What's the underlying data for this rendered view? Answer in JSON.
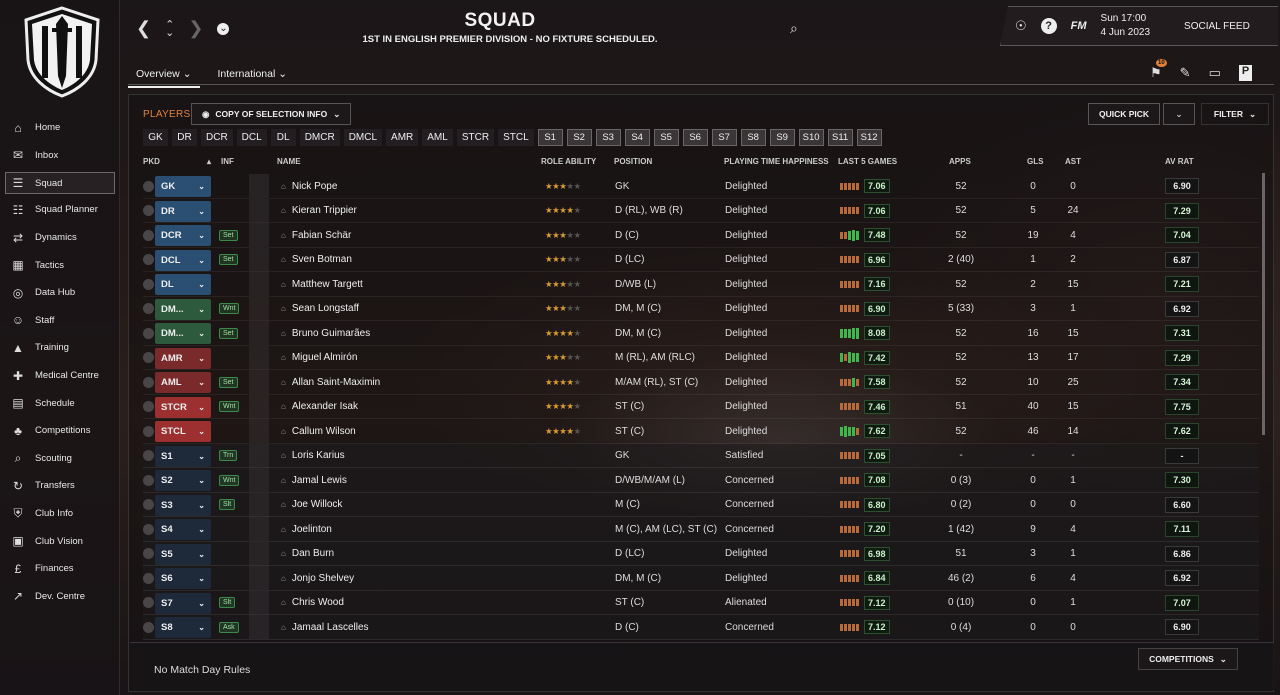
{
  "header": {
    "title": "SQUAD",
    "subtitle": "1ST IN ENGLISH PREMIER DIVISION - NO FIXTURE SCHEDULED.",
    "fm": "FM",
    "time": "Sun 17:00",
    "date": "4 Jun 2023",
    "social_feed": "SOCIAL FEED",
    "notif_count": "10"
  },
  "sidebar": {
    "items": [
      {
        "label": "Home",
        "icon": "home-icon"
      },
      {
        "label": "Inbox",
        "icon": "inbox-icon"
      },
      {
        "label": "Squad",
        "icon": "squad-icon"
      },
      {
        "label": "Squad Planner",
        "icon": "clipboard-icon"
      },
      {
        "label": "Dynamics",
        "icon": "dynamics-icon"
      },
      {
        "label": "Tactics",
        "icon": "tactics-icon"
      },
      {
        "label": "Data Hub",
        "icon": "data-hub-icon"
      },
      {
        "label": "Staff",
        "icon": "staff-icon"
      },
      {
        "label": "Training",
        "icon": "training-icon"
      },
      {
        "label": "Medical Centre",
        "icon": "medical-icon"
      },
      {
        "label": "Schedule",
        "icon": "calendar-icon"
      },
      {
        "label": "Competitions",
        "icon": "trophy-icon"
      },
      {
        "label": "Scouting",
        "icon": "scouting-icon"
      },
      {
        "label": "Transfers",
        "icon": "transfers-icon"
      },
      {
        "label": "Club Info",
        "icon": "shield-icon"
      },
      {
        "label": "Club Vision",
        "icon": "briefcase-icon"
      },
      {
        "label": "Finances",
        "icon": "finances-icon"
      },
      {
        "label": "Dev. Centre",
        "icon": "dev-centre-icon"
      }
    ]
  },
  "tabs": {
    "overview": "Overview",
    "international": "International"
  },
  "toolbar": {
    "players": "PLAYERS",
    "copy": "COPY OF SELECTION INFO",
    "quick_pick": "QUICK PICK",
    "filter": "FILTER"
  },
  "position_chips": [
    "GK",
    "DR",
    "DCR",
    "DCL",
    "DL",
    "DMCR",
    "DMCL",
    "AMR",
    "AML",
    "STCR",
    "STCL"
  ],
  "sub_chips": [
    "S1",
    "S2",
    "S3",
    "S4",
    "S5",
    "S6",
    "S7",
    "S8",
    "S9",
    "S10",
    "S11",
    "S12"
  ],
  "columns": {
    "pkd": "PKD",
    "inf": "INF",
    "name": "NAME",
    "role_ability": "ROLE ABILITY",
    "position": "POSITION",
    "happiness": "PLAYING TIME HAPPINESS",
    "last5": "LAST 5 GAMES",
    "apps": "APPS",
    "gls": "GLS",
    "ast": "AST",
    "av_rat": "AV RAT"
  },
  "players": [
    {
      "pkd": "GK",
      "pkd_color": "#2a4f72",
      "inf": "",
      "name": "Nick Pope",
      "stars": 3,
      "position": "GK",
      "happiness": "Delighted",
      "last5": "7.06",
      "apps": "52",
      "gls": "0",
      "ast": "0",
      "avrat": "6.90",
      "sub": false
    },
    {
      "pkd": "DR",
      "pkd_color": "#2a4f72",
      "inf": "",
      "name": "Kieran Trippier",
      "stars": 3.5,
      "position": "D (RL), WB (R)",
      "happiness": "Delighted",
      "last5": "7.06",
      "apps": "52",
      "gls": "5",
      "ast": "24",
      "avrat": "7.29",
      "sub": false
    },
    {
      "pkd": "DCR",
      "pkd_color": "#2a4f72",
      "inf": "Set",
      "name": "Fabian Schär",
      "stars": 3,
      "position": "D (C)",
      "happiness": "Delighted",
      "last5": "7.48",
      "apps": "52",
      "gls": "19",
      "ast": "4",
      "avrat": "7.04",
      "sub": false
    },
    {
      "pkd": "DCL",
      "pkd_color": "#2a4f72",
      "inf": "Set",
      "name": "Sven Botman",
      "stars": 3,
      "position": "D (LC)",
      "happiness": "Delighted",
      "last5": "6.96",
      "apps": "2 (40)",
      "gls": "1",
      "ast": "2",
      "avrat": "6.87",
      "sub": false
    },
    {
      "pkd": "DL",
      "pkd_color": "#2a4f72",
      "inf": "",
      "name": "Matthew Targett",
      "stars": 3,
      "position": "D/WB (L)",
      "happiness": "Delighted",
      "last5": "7.16",
      "apps": "52",
      "gls": "2",
      "ast": "15",
      "avrat": "7.21",
      "sub": false
    },
    {
      "pkd": "DM...",
      "pkd_color": "#2d5a3c",
      "inf": "Wnt",
      "name": "Sean Longstaff",
      "stars": 2.5,
      "position": "DM, M (C)",
      "happiness": "Delighted",
      "last5": "6.90",
      "apps": "5 (33)",
      "gls": "3",
      "ast": "1",
      "avrat": "6.92",
      "sub": false
    },
    {
      "pkd": "DM...",
      "pkd_color": "#2d5a3c",
      "inf": "Set",
      "name": "Bruno Guimarães",
      "stars": 3.5,
      "position": "DM, M (C)",
      "happiness": "Delighted",
      "last5": "8.08",
      "apps": "52",
      "gls": "16",
      "ast": "15",
      "avrat": "7.31",
      "sub": false
    },
    {
      "pkd": "AMR",
      "pkd_color": "#7a2a2a",
      "inf": "",
      "name": "Miguel Almirón",
      "stars": 3,
      "position": "M (RL), AM (RLC)",
      "happiness": "Delighted",
      "last5": "7.42",
      "apps": "52",
      "gls": "13",
      "ast": "17",
      "avrat": "7.29",
      "sub": false
    },
    {
      "pkd": "AML",
      "pkd_color": "#7a2a2a",
      "inf": "Set",
      "name": "Allan Saint-Maximin",
      "stars": 3.5,
      "position": "M/AM (RL), ST (C)",
      "happiness": "Delighted",
      "last5": "7.58",
      "apps": "52",
      "gls": "10",
      "ast": "25",
      "avrat": "7.34",
      "sub": false
    },
    {
      "pkd": "STCR",
      "pkd_color": "#9c3030",
      "inf": "Wnt",
      "name": "Alexander Isak",
      "stars": 4,
      "position": "ST (C)",
      "happiness": "Delighted",
      "last5": "7.46",
      "apps": "51",
      "gls": "40",
      "ast": "15",
      "avrat": "7.75",
      "sub": false
    },
    {
      "pkd": "STCL",
      "pkd_color": "#9c3030",
      "inf": "",
      "name": "Callum Wilson",
      "stars": 3.5,
      "position": "ST (C)",
      "happiness": "Delighted",
      "last5": "7.62",
      "apps": "52",
      "gls": "46",
      "ast": "14",
      "avrat": "7.62",
      "sub": false
    },
    {
      "pkd": "S1",
      "pkd_color": "#1e2a3a",
      "inf": "Trn",
      "name": "Loris Karius",
      "stars": 0,
      "position": "GK",
      "happiness": "Satisfied",
      "last5": "7.05",
      "apps": "-",
      "gls": "-",
      "ast": "-",
      "avrat": "-",
      "sub": true
    },
    {
      "pkd": "S2",
      "pkd_color": "#1e2a3a",
      "inf": "Wnt",
      "name": "Jamal Lewis",
      "stars": 0,
      "position": "D/WB/M/AM (L)",
      "happiness": "Concerned",
      "last5": "7.08",
      "apps": "0 (3)",
      "gls": "0",
      "ast": "1",
      "avrat": "7.30",
      "sub": true
    },
    {
      "pkd": "S3",
      "pkd_color": "#1e2a3a",
      "inf": "Slt",
      "name": "Joe Willock",
      "stars": 0,
      "position": "M (C)",
      "happiness": "Concerned",
      "last5": "6.80",
      "apps": "0 (2)",
      "gls": "0",
      "ast": "0",
      "avrat": "6.60",
      "sub": true
    },
    {
      "pkd": "S4",
      "pkd_color": "#1e2a3a",
      "inf": "",
      "name": "Joelinton",
      "stars": 0,
      "position": "M (C), AM (LC), ST (C)",
      "happiness": "Concerned",
      "last5": "7.20",
      "apps": "1 (42)",
      "gls": "9",
      "ast": "4",
      "avrat": "7.11",
      "sub": true
    },
    {
      "pkd": "S5",
      "pkd_color": "#1e2a3a",
      "inf": "",
      "name": "Dan Burn",
      "stars": 0,
      "position": "D (LC)",
      "happiness": "Delighted",
      "last5": "6.98",
      "apps": "51",
      "gls": "3",
      "ast": "1",
      "avrat": "6.86",
      "sub": true
    },
    {
      "pkd": "S6",
      "pkd_color": "#1e2a3a",
      "inf": "",
      "name": "Jonjo Shelvey",
      "stars": 0,
      "position": "DM, M (C)",
      "happiness": "Delighted",
      "last5": "6.84",
      "apps": "46 (2)",
      "gls": "6",
      "ast": "4",
      "avrat": "6.92",
      "sub": true
    },
    {
      "pkd": "S7",
      "pkd_color": "#1e2a3a",
      "inf": "Slt",
      "name": "Chris Wood",
      "stars": 0,
      "position": "ST (C)",
      "happiness": "Alienated",
      "last5": "7.12",
      "apps": "0 (10)",
      "gls": "0",
      "ast": "1",
      "avrat": "7.07",
      "sub": true
    },
    {
      "pkd": "S8",
      "pkd_color": "#1e2a3a",
      "inf": "Ask",
      "name": "Jamaal Lascelles",
      "stars": 0,
      "position": "D (C)",
      "happiness": "Concerned",
      "last5": "7.12",
      "apps": "0 (4)",
      "gls": "0",
      "ast": "0",
      "avrat": "6.90",
      "sub": true
    }
  ],
  "footer": {
    "rules": "No Match Day Rules",
    "competitions": "COMPETITIONS"
  }
}
